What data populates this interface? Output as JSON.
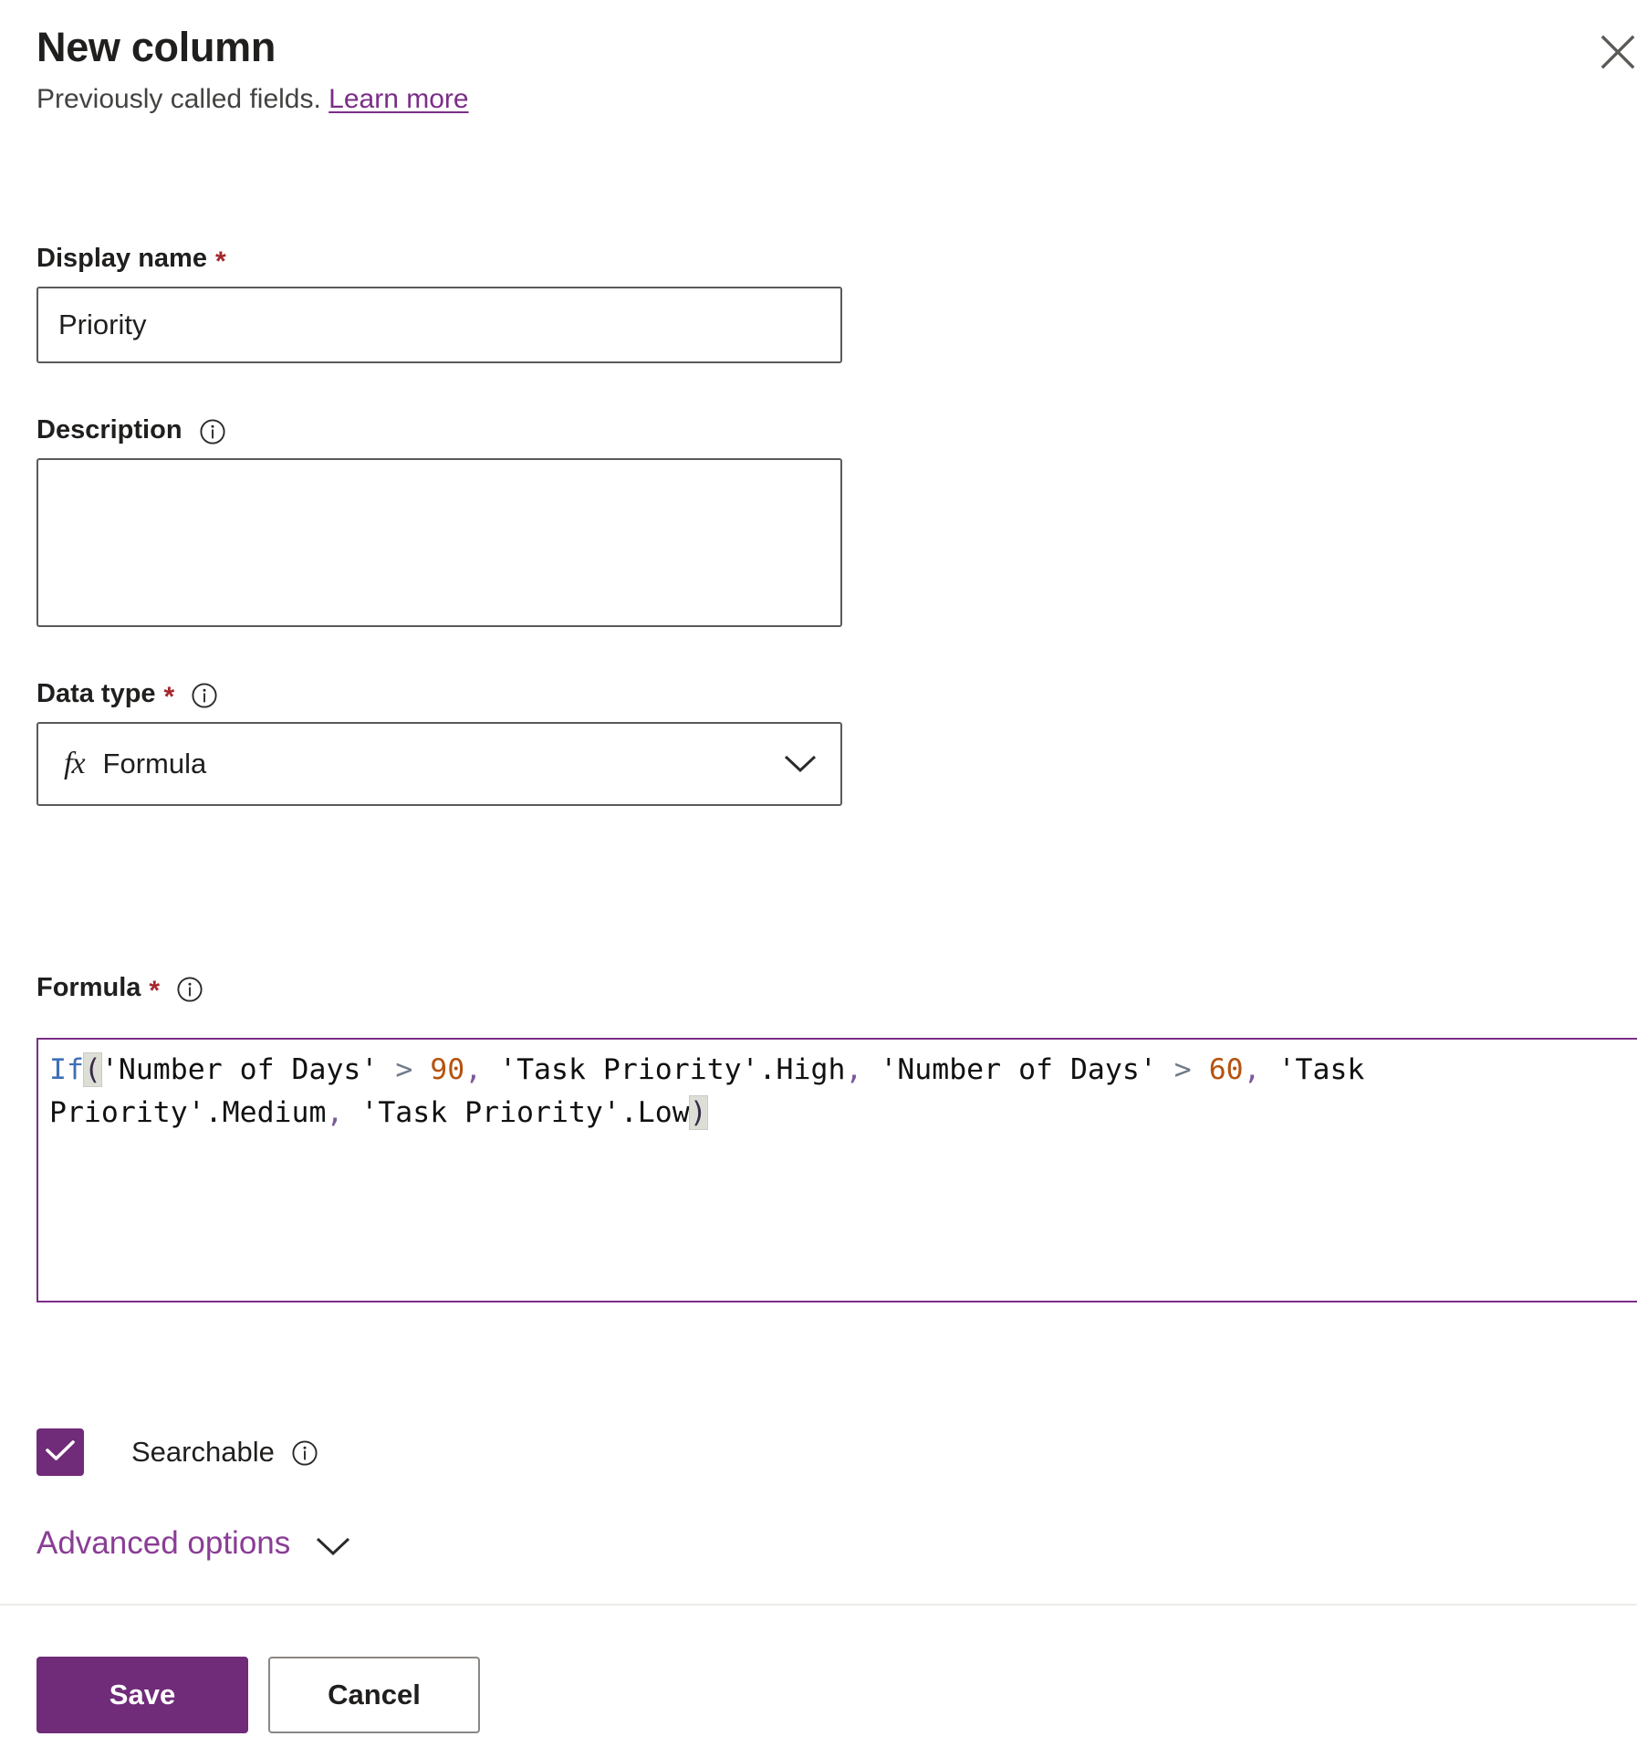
{
  "header": {
    "title": "New column",
    "subtitle_prefix": "Previously called fields.",
    "learn_more": "Learn more",
    "close_icon": "close-icon"
  },
  "fields": {
    "display_name": {
      "label": "Display name",
      "required_marker": "*",
      "value": "Priority",
      "placeholder": ""
    },
    "description": {
      "label": "Description",
      "info_icon": "info-icon",
      "value": "",
      "placeholder": ""
    },
    "data_type": {
      "label": "Data type",
      "required_marker": "*",
      "info_icon": "info-icon",
      "type_icon": "fx",
      "selected": "Formula",
      "chevron_icon": "chevron-down-icon"
    },
    "formula": {
      "label": "Formula",
      "required_marker": "*",
      "info_icon": "info-icon",
      "text": "If('Number of Days' > 90, 'Task Priority'.High, 'Number of Days' > 60, 'Task Priority'.Medium, 'Task Priority'.Low)",
      "tokens": [
        {
          "t": "If",
          "c": "tok-fn"
        },
        {
          "t": "(",
          "c": "tok-paren-hl"
        },
        {
          "t": "'Number of Days'",
          "c": "tok-str"
        },
        {
          "t": " ",
          "c": "tok-str"
        },
        {
          "t": ">",
          "c": "tok-op"
        },
        {
          "t": " ",
          "c": "tok-str"
        },
        {
          "t": "90",
          "c": "tok-num"
        },
        {
          "t": ",",
          "c": "tok-comma"
        },
        {
          "t": " 'Task Priority'.High",
          "c": "tok-str"
        },
        {
          "t": ",",
          "c": "tok-comma"
        },
        {
          "t": " 'Number of Days'",
          "c": "tok-str"
        },
        {
          "t": " ",
          "c": "tok-str"
        },
        {
          "t": ">",
          "c": "tok-op"
        },
        {
          "t": " ",
          "c": "tok-str"
        },
        {
          "t": "60",
          "c": "tok-num"
        },
        {
          "t": ",",
          "c": "tok-comma"
        },
        {
          "t": " 'Task Priority'.Medium",
          "c": "tok-str"
        },
        {
          "t": ",",
          "c": "tok-comma"
        },
        {
          "t": " 'Task Priority'.Low",
          "c": "tok-str"
        },
        {
          "t": ")",
          "c": "tok-paren-hl"
        }
      ]
    },
    "searchable": {
      "label": "Searchable",
      "checked": true,
      "check_icon": "checkmark-icon",
      "info_icon": "info-icon"
    }
  },
  "advanced_options": {
    "label": "Advanced options",
    "chevron_icon": "chevron-down-icon",
    "expanded": false
  },
  "footer": {
    "save_label": "Save",
    "cancel_label": "Cancel"
  },
  "colors": {
    "accent_purple": "#702b79",
    "link_purple": "#7b2e87",
    "required_red": "#a4262c",
    "border_gray": "#5a5a5a",
    "code_keyword_blue": "#3f6fb5",
    "code_number_orange": "#b5530f",
    "code_comma_purple": "#7a5a9a"
  }
}
